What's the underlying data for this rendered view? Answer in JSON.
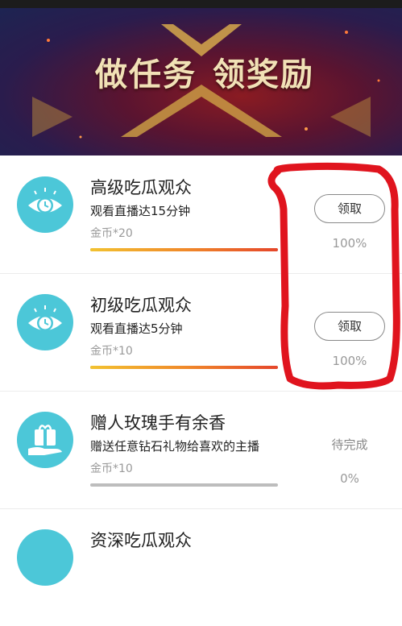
{
  "banner": {
    "title_part1": "做任务",
    "title_part2": "领奖励"
  },
  "tasks": [
    {
      "title": "高级吃瓜观众",
      "desc": "观看直播达15分钟",
      "reward": "金币*20",
      "action": "领取",
      "progress_label": "100%",
      "progress": 1.0,
      "icon": "eye-clock-icon"
    },
    {
      "title": "初级吃瓜观众",
      "desc": "观看直播达5分钟",
      "reward": "金币*10",
      "action": "领取",
      "progress_label": "100%",
      "progress": 1.0,
      "icon": "eye-clock-icon"
    },
    {
      "title": "赠人玫瑰手有余香",
      "desc": "赠送任意钻石礼物给喜欢的主播",
      "reward": "金币*10",
      "status": "待完成",
      "progress_label": "0%",
      "progress": 0.0,
      "icon": "gift-hand-icon"
    },
    {
      "title": "资深吃瓜观众"
    }
  ],
  "colors": {
    "icon_bg": "#4cc7d8",
    "progress_start": "#f2c230",
    "progress_end": "#e5462a",
    "annotation": "#e0141e"
  }
}
